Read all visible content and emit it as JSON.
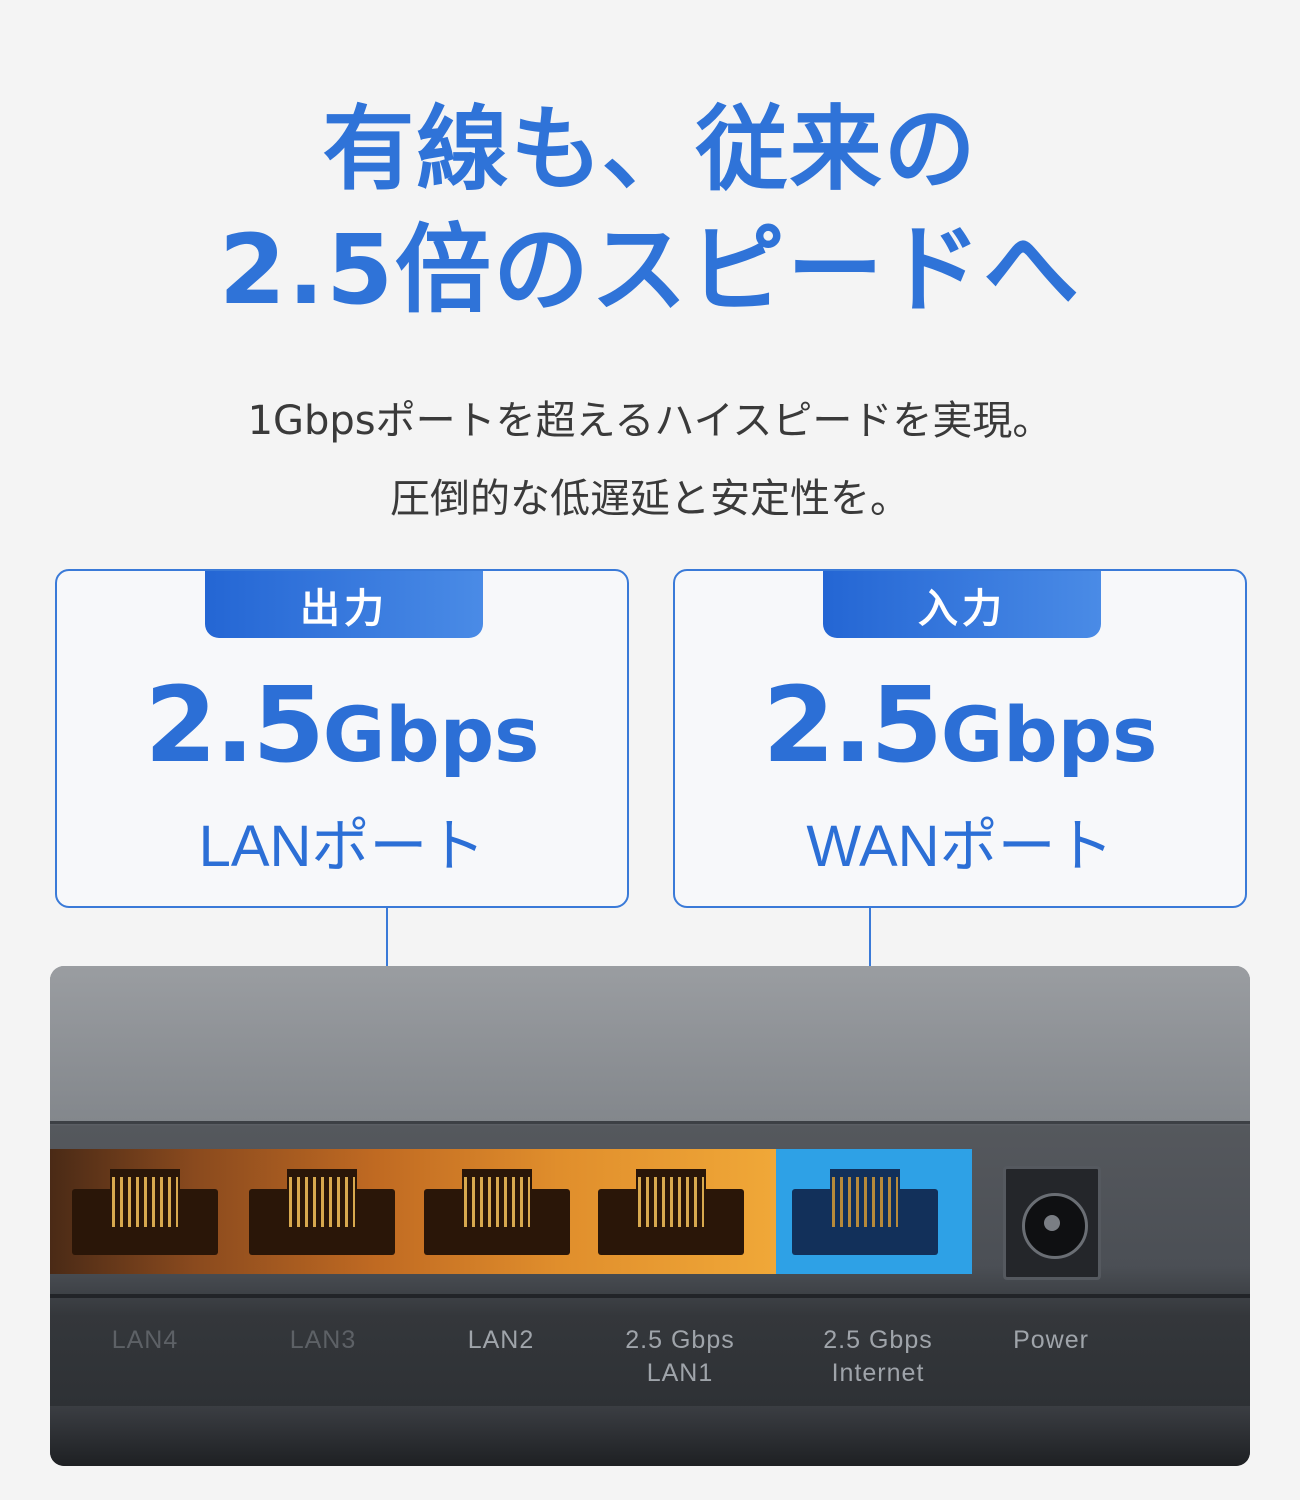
{
  "headline": {
    "line1": "有線も、従来の",
    "line2": "2.5倍のスピードへ"
  },
  "subtext": {
    "line1": "1Gbpsポートを超えるハイスピードを実現。",
    "line2": "圧倒的な低遅延と安定性を。"
  },
  "cards": [
    {
      "tab": "出力",
      "speed_number": "2.5",
      "speed_unit": "Gbps",
      "port": "LANポート"
    },
    {
      "tab": "入力",
      "speed_number": "2.5",
      "speed_unit": "Gbps",
      "port": "WANポート"
    }
  ],
  "router_ports": [
    {
      "line1": "LAN4",
      "line2": ""
    },
    {
      "line1": "LAN3",
      "line2": ""
    },
    {
      "line1": "LAN2",
      "line2": ""
    },
    {
      "line1": "2.5 Gbps",
      "line2": "LAN1"
    },
    {
      "line1": "2.5 Gbps",
      "line2": "Internet"
    },
    {
      "line1": "Power",
      "line2": ""
    }
  ],
  "colors": {
    "accent": "#2f73d8",
    "lan_port": "#e08e2c",
    "wan_port": "#2ea1e6"
  }
}
